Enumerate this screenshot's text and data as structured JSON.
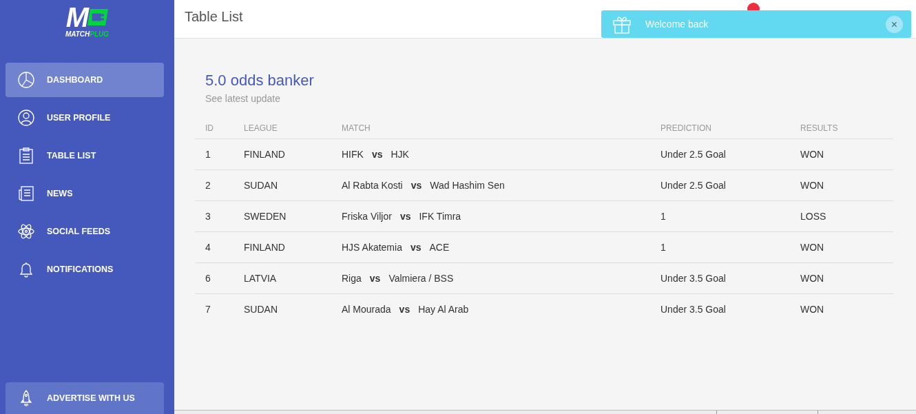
{
  "logo": {
    "mark": "M",
    "brand_left": "MATCH",
    "brand_right": "PLUG"
  },
  "sidebar": {
    "items": [
      {
        "label": "DASHBOARD",
        "selected": true
      },
      {
        "label": "USER PROFILE",
        "selected": false
      },
      {
        "label": "TABLE LIST",
        "selected": false
      },
      {
        "label": "NEWS",
        "selected": false
      },
      {
        "label": "SOCIAL FEEDS",
        "selected": false
      },
      {
        "label": "NOTIFICATIONS",
        "selected": false
      }
    ],
    "footer_item": {
      "label": "ADVERTISE WITH US"
    }
  },
  "header": {
    "title": "Table List"
  },
  "toast": {
    "message": "Welcome back",
    "close": "×"
  },
  "card": {
    "title": "5.0 odds banker",
    "subtitle": "See latest update"
  },
  "table": {
    "columns": [
      "ID",
      "LEAGUE",
      "MATCH",
      "PREDICTION",
      "RESULTS"
    ],
    "rows": [
      {
        "id": "1",
        "league": "FINLAND",
        "home": "HIFK",
        "vs": "vs",
        "away": "HJK",
        "prediction": "Under 2.5 Goal",
        "result": "WON"
      },
      {
        "id": "2",
        "league": "SUDAN",
        "home": "Al Rabta Kosti",
        "vs": "vs",
        "away": "Wad Hashim Sen",
        "prediction": "Under 2.5 Goal",
        "result": "WON"
      },
      {
        "id": "3",
        "league": "SWEDEN",
        "home": "Friska Viljor",
        "vs": "vs",
        "away": "IFK Timra",
        "prediction": "1",
        "result": "LOSS"
      },
      {
        "id": "4",
        "league": "FINLAND",
        "home": "HJS Akatemia",
        "vs": "vs",
        "away": "ACE",
        "prediction": "1",
        "result": "WON"
      },
      {
        "id": "6",
        "league": "LATVIA",
        "home": "Riga",
        "vs": "vs",
        "away": "Valmiera / BSS",
        "prediction": "Under 3.5 Goal",
        "result": "WON"
      },
      {
        "id": "7",
        "league": "SUDAN",
        "home": "Al Mourada",
        "vs": "vs",
        "away": "Hay Al Arab",
        "prediction": "Under 3.5 Goal",
        "result": "WON"
      }
    ]
  }
}
